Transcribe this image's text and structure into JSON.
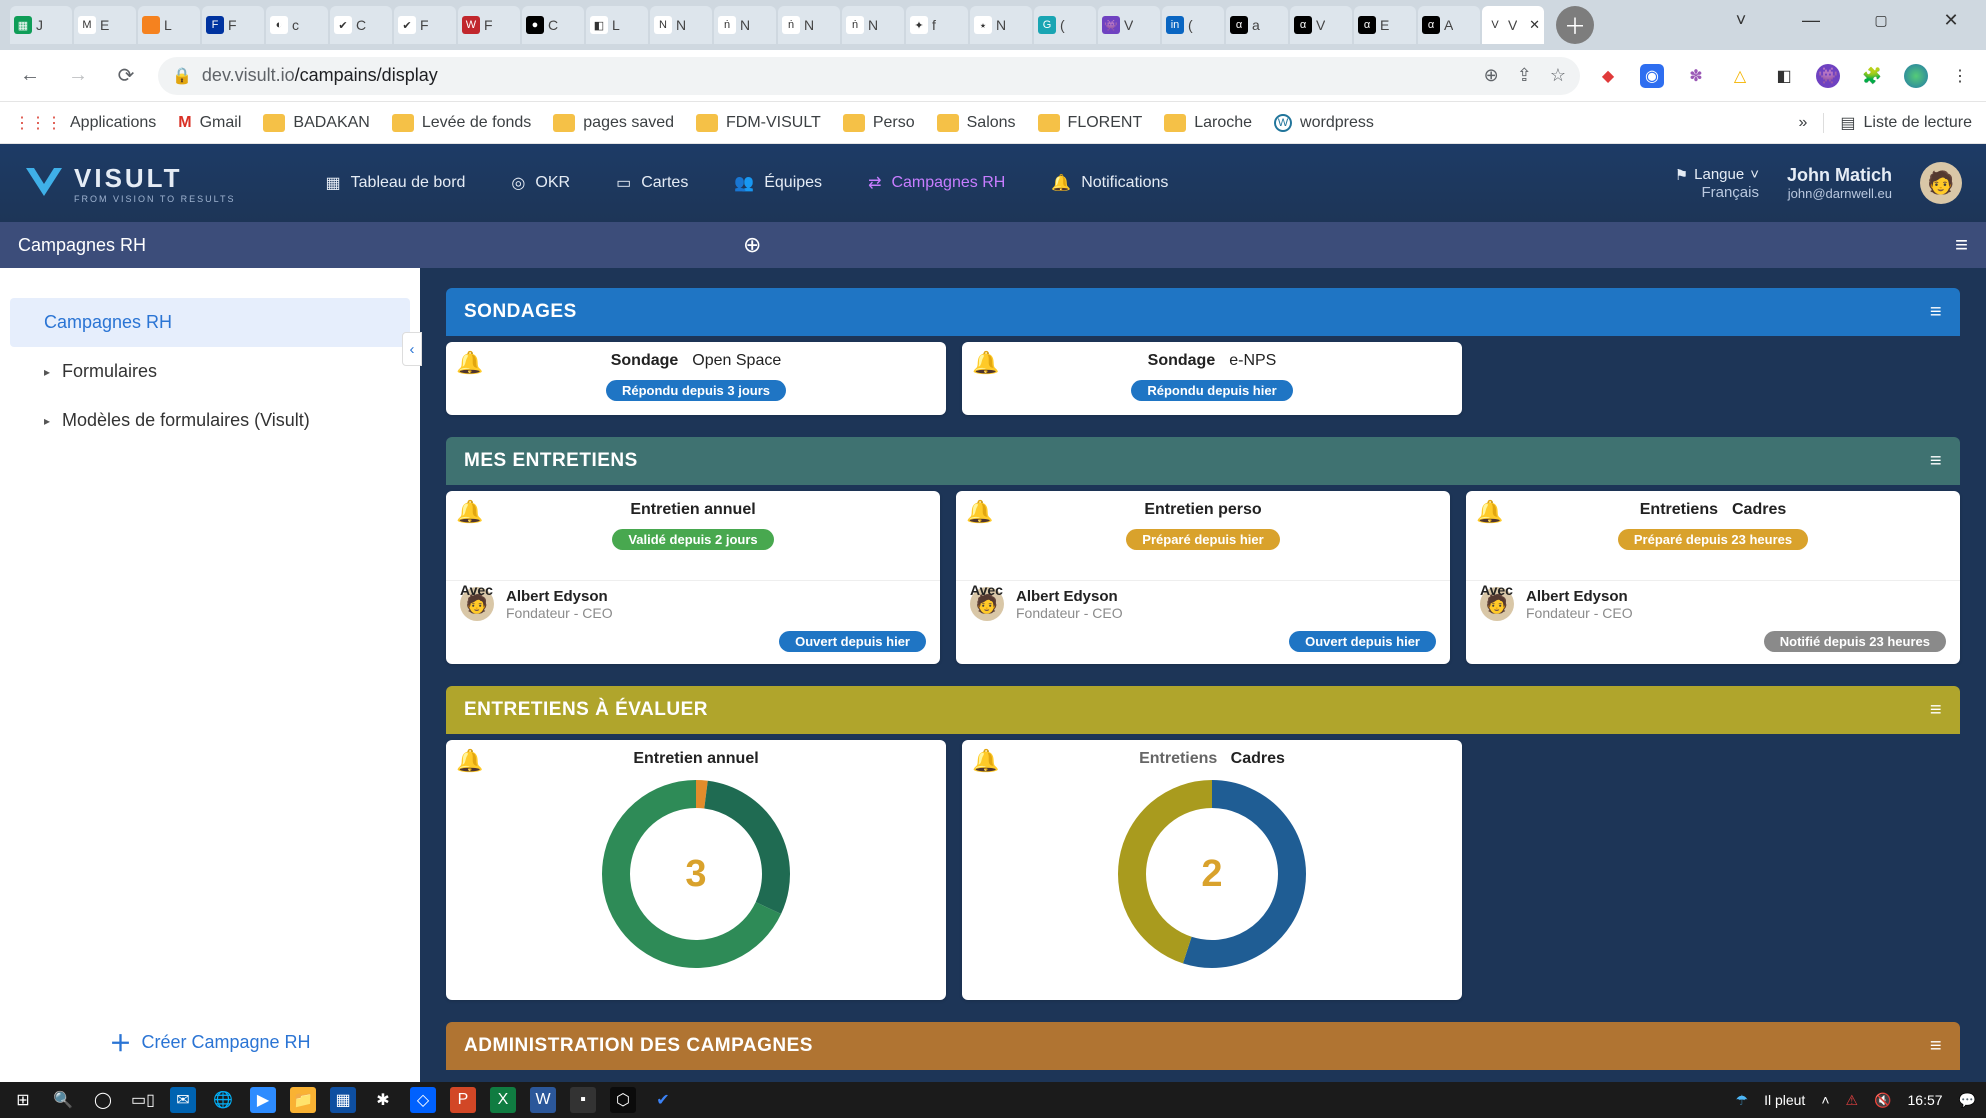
{
  "browser": {
    "url_host": "dev.visult.io",
    "url_path": "/campains/display",
    "tabs": [
      {
        "fav_bg": "#0f9d58",
        "fav_txt": "▦",
        "label": "J"
      },
      {
        "fav_bg": "#ffffff",
        "fav_txt": "M",
        "label": "E"
      },
      {
        "fav_bg": "#f5821f",
        "fav_txt": "",
        "label": "L"
      },
      {
        "fav_bg": "#0033a0",
        "fav_txt": "F",
        "label": "F"
      },
      {
        "fav_bg": "#ffffff",
        "fav_txt": "◐",
        "label": "c"
      },
      {
        "fav_bg": "#ffffff",
        "fav_txt": "✔",
        "label": "C"
      },
      {
        "fav_bg": "#ffffff",
        "fav_txt": "✔",
        "label": "F"
      },
      {
        "fav_bg": "#c1272d",
        "fav_txt": "W",
        "label": "F"
      },
      {
        "fav_bg": "#000000",
        "fav_txt": "●",
        "label": "C"
      },
      {
        "fav_bg": "#ffffff",
        "fav_txt": "◧",
        "label": "L"
      },
      {
        "fav_bg": "#ffffff",
        "fav_txt": "N",
        "label": "N"
      },
      {
        "fav_bg": "#ffffff",
        "fav_txt": "ṅ",
        "label": "N"
      },
      {
        "fav_bg": "#ffffff",
        "fav_txt": "ṅ",
        "label": "N"
      },
      {
        "fav_bg": "#ffffff",
        "fav_txt": "ṅ",
        "label": "N"
      },
      {
        "fav_bg": "#ffffff",
        "fav_txt": "✦",
        "label": "f"
      },
      {
        "fav_bg": "#ffffff",
        "fav_txt": "٭",
        "label": "N"
      },
      {
        "fav_bg": "#19a5b3",
        "fav_txt": "G",
        "label": "("
      },
      {
        "fav_bg": "#6f42c1",
        "fav_txt": "👾",
        "label": "V"
      },
      {
        "fav_bg": "#0a66c2",
        "fav_txt": "in",
        "label": "("
      },
      {
        "fav_bg": "#000000",
        "fav_txt": "α",
        "label": "a"
      },
      {
        "fav_bg": "#000000",
        "fav_txt": "α",
        "label": "V"
      },
      {
        "fav_bg": "#000000",
        "fav_txt": "α",
        "label": "E"
      },
      {
        "fav_bg": "#000000",
        "fav_txt": "α",
        "label": "A"
      },
      {
        "fav_bg": "#ffffff",
        "fav_txt": "V",
        "label": "V",
        "active": true
      }
    ],
    "bookmarks": {
      "apps": "Applications",
      "items": [
        {
          "icon": "gmail",
          "label": "Gmail"
        },
        {
          "icon": "folder",
          "label": "BADAKAN"
        },
        {
          "icon": "folder",
          "label": "Levée de fonds"
        },
        {
          "icon": "folder",
          "label": "pages saved"
        },
        {
          "icon": "folder",
          "label": "FDM-VISULT"
        },
        {
          "icon": "folder",
          "label": "Perso"
        },
        {
          "icon": "folder",
          "label": "Salons"
        },
        {
          "icon": "folder",
          "label": "FLORENT"
        },
        {
          "icon": "folder",
          "label": "Laroche"
        },
        {
          "icon": "wp",
          "label": "wordpress"
        }
      ],
      "overflow": "»",
      "reading": "Liste de lecture"
    }
  },
  "app": {
    "brand": "VISULT",
    "brand_sub": "FROM VISION TO RESULTS",
    "nav": {
      "dashboard": "Tableau de bord",
      "okr": "OKR",
      "cards": "Cartes",
      "teams": "Équipes",
      "campaigns": "Campagnes RH",
      "notifications": "Notifications"
    },
    "lang": {
      "label": "Langue",
      "value": "Français"
    },
    "user": {
      "name": "John Matich",
      "email": "john@darnwell.eu"
    },
    "subheader_title": "Campagnes RH"
  },
  "sidebar": {
    "items": [
      {
        "label": "Campagnes RH",
        "active": true
      },
      {
        "label": "Formulaires",
        "caret": true
      },
      {
        "label": "Modèles de formulaires (Visult)",
        "caret": true
      }
    ],
    "create": "Créer Campagne RH"
  },
  "sections": {
    "sondages": {
      "title": "SONDAGES",
      "cards": [
        {
          "type": "Sondage",
          "name": "Open Space",
          "pill": "Répondu depuis 3 jours",
          "pill_style": "blue"
        },
        {
          "type": "Sondage",
          "name": "e-NPS",
          "pill": "Répondu depuis hier",
          "pill_style": "blue"
        }
      ]
    },
    "entretiens": {
      "title": "MES ENTRETIENS",
      "avec_label": "Avec",
      "cards": [
        {
          "title": "Entretien annuel",
          "pill": "Validé depuis 2 jours",
          "pill_style": "green",
          "person_name": "Albert Edyson",
          "person_role": "Fondateur - CEO",
          "pill2": "Ouvert depuis hier",
          "pill2_style": "blue"
        },
        {
          "title": "Entretien perso",
          "pill": "Préparé depuis hier",
          "pill_style": "amber",
          "person_name": "Albert Edyson",
          "person_role": "Fondateur - CEO",
          "pill2": "Ouvert depuis hier",
          "pill2_style": "blue"
        },
        {
          "title_a": "Entretiens",
          "title_b": "Cadres",
          "pill": "Préparé depuis 23 heures",
          "pill_style": "amber",
          "person_name": "Albert Edyson",
          "person_role": "Fondateur - CEO",
          "pill2": "Notifié depuis 23 heures",
          "pill2_style": "gray"
        }
      ]
    },
    "evaluer": {
      "title": "ENTRETIENS À ÉVALUER",
      "cards": [
        {
          "title": "Entretien annuel",
          "value": "3"
        },
        {
          "title_a": "Entretiens",
          "title_b": "Cadres",
          "value": "2"
        }
      ]
    },
    "admin": {
      "title": "ADMINISTRATION DES CAMPAGNES"
    }
  },
  "chart_data": [
    {
      "type": "pie",
      "title": "Entretien annuel",
      "center_value": 3,
      "series": [
        {
          "name": "orange",
          "value": 2,
          "color": "#e28c2b"
        },
        {
          "name": "dark-green",
          "value": 30,
          "color": "#1f6b52"
        },
        {
          "name": "green",
          "value": 68,
          "color": "#2e8b57"
        }
      ]
    },
    {
      "type": "pie",
      "title": "Entretiens Cadres",
      "center_value": 2,
      "series": [
        {
          "name": "blue",
          "value": 55,
          "color": "#1f5d94"
        },
        {
          "name": "olive",
          "value": 45,
          "color": "#a99b1e"
        }
      ]
    }
  ],
  "taskbar": {
    "weather": "Il pleut",
    "clock": "16:57"
  }
}
